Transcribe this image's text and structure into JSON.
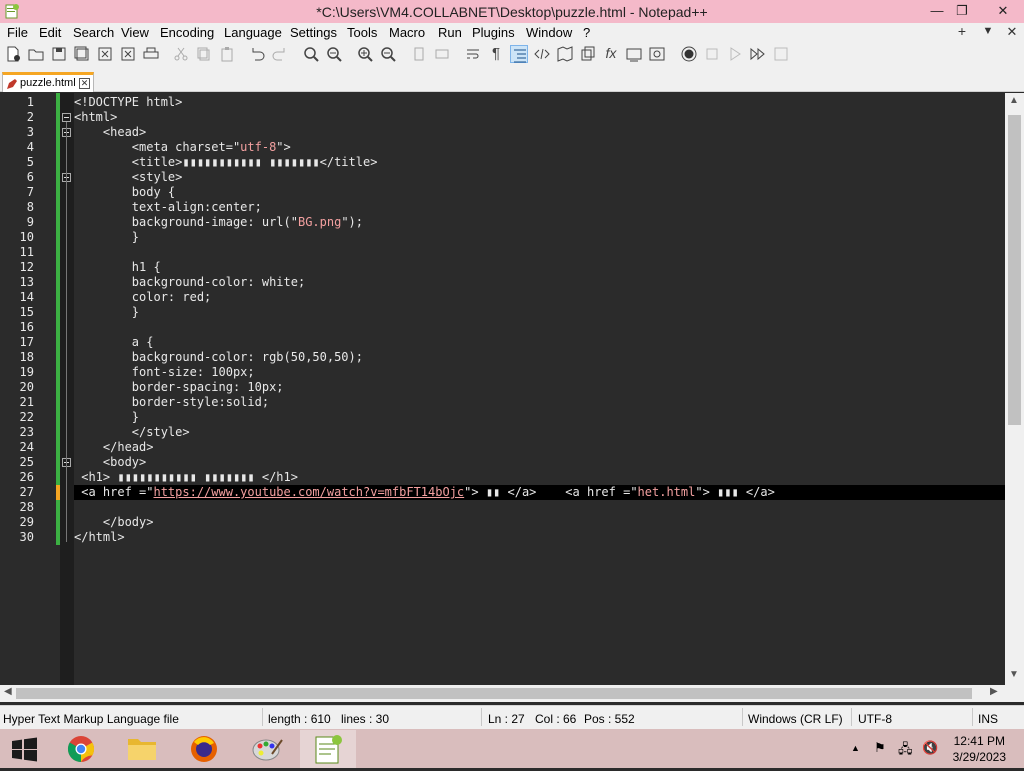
{
  "window": {
    "title": "*C:\\Users\\VM4.COLLABNET\\Desktop\\puzzle.html - Notepad++"
  },
  "menu": [
    "File",
    "Edit",
    "Search",
    "View",
    "Encoding",
    "Language",
    "Settings",
    "Tools",
    "Macro",
    "Run",
    "Plugins",
    "Window",
    "?"
  ],
  "menu_right": [
    "+",
    "▼",
    "✕"
  ],
  "tab": {
    "label": "puzzle.html"
  },
  "editor": {
    "current_line": 27,
    "lines": [
      "<!DOCTYPE html>",
      "<html>",
      "    <head>",
      "        <meta charset=\"utf-8\">",
      "        <title>▮▮▮▮▮▮▮▮▮▮▮ ▮▮▮▮▮▮▮</title>",
      "        <style>",
      "        body {",
      "        text-align:center;",
      "        background-image: url(\"BG.png\");",
      "        }",
      "",
      "        h1 {",
      "        background-color: white;",
      "        color: red;",
      "        }",
      "",
      "        a {",
      "        background-color: rgb(50,50,50);",
      "        font-size: 100px;",
      "        border-spacing: 10px;",
      "        border-style:solid;",
      "        }",
      "        </style>",
      "    </head>",
      "    <body>",
      " <h1> ▮▮▮▮▮▮▮▮▮▮▮ ▮▮▮▮▮▮▮ </h1>",
      " <a href =\"https://www.youtube.com/watch?v=mfbFT14bOjc\"> ▮▮ </a>    <a href =\"het.html\"> ▮▮▮ </a>",
      "",
      "    </body>",
      "</html>"
    ]
  },
  "status": {
    "filetype": "Hyper Text Markup Language file",
    "length": "length : 610",
    "lines": "lines : 30",
    "ln": "Ln : 27",
    "col": "Col : 66",
    "pos": "Pos : 552",
    "eol": "Windows (CR LF)",
    "encoding": "UTF-8",
    "mode": "INS"
  },
  "taskbar": {
    "time": "12:41 PM",
    "date": "3/29/2023",
    "apps": [
      "windows-start",
      "chrome",
      "file-explorer",
      "firefox",
      "paint",
      "notepad-plus-plus"
    ]
  },
  "colors": {
    "titlebar": "#f4b9c9",
    "editor_bg": "#2b2b2b",
    "current_line_bg": "#000000",
    "string": "#f3a0a0",
    "change_bar": "#3cb043",
    "change_bar_unsaved": "#f5a623",
    "taskbar": "#d9bdbd"
  }
}
